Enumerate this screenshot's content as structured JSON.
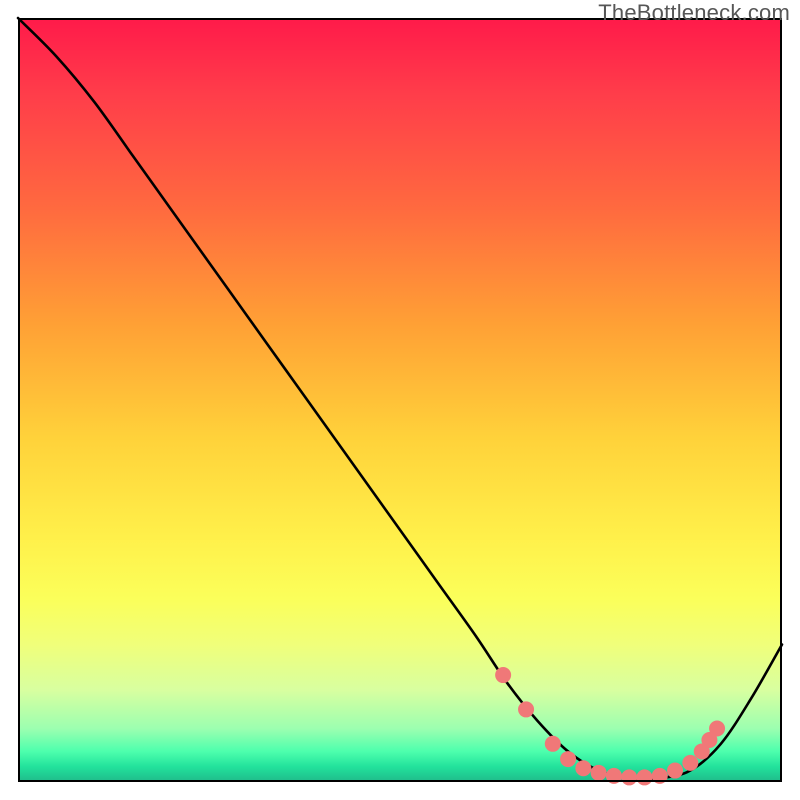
{
  "attribution": "TheBottleneck.com",
  "chart_data": {
    "type": "line",
    "title": "",
    "xlabel": "",
    "ylabel": "",
    "xlim": [
      0,
      100
    ],
    "ylim": [
      0,
      100
    ],
    "series": [
      {
        "name": "bottleneck-curve",
        "x": [
          0,
          5,
          10,
          15,
          20,
          25,
          30,
          35,
          40,
          45,
          50,
          55,
          60,
          64,
          68,
          72,
          76,
          80,
          84,
          88,
          92,
          96,
          100
        ],
        "y": [
          100,
          95,
          89,
          82,
          75,
          68,
          61,
          54,
          47,
          40,
          33,
          26,
          19,
          13,
          8,
          4,
          1.5,
          0.5,
          0.5,
          1.5,
          5,
          11,
          18
        ]
      }
    ],
    "markers": {
      "name": "highlight-dots",
      "color": "#f07878",
      "points": [
        {
          "x": 63.5,
          "y": 14
        },
        {
          "x": 66.5,
          "y": 9.5
        },
        {
          "x": 70,
          "y": 5
        },
        {
          "x": 72,
          "y": 3
        },
        {
          "x": 74,
          "y": 1.8
        },
        {
          "x": 76,
          "y": 1.2
        },
        {
          "x": 78,
          "y": 0.8
        },
        {
          "x": 80,
          "y": 0.6
        },
        {
          "x": 82,
          "y": 0.6
        },
        {
          "x": 84,
          "y": 0.8
        },
        {
          "x": 86,
          "y": 1.5
        },
        {
          "x": 88,
          "y": 2.5
        },
        {
          "x": 89.5,
          "y": 4
        },
        {
          "x": 90.5,
          "y": 5.5
        },
        {
          "x": 91.5,
          "y": 7
        }
      ]
    }
  }
}
